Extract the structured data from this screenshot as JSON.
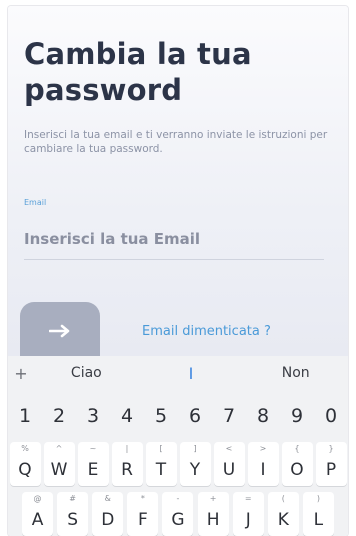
{
  "screen": {
    "title": "Cambia la tua password",
    "description": "Inserisci la tua email e ti verranno inviate le istruzioni per cambiare la tua password.",
    "email_label": "Email",
    "email_placeholder": "Inserisci la tua Email",
    "submit_icon": "arrow-right-icon",
    "forgot_link": "Email dimenticata ?",
    "colors": {
      "accent": "#4a9ad8",
      "title": "#2c3448",
      "button": "#a8aebf"
    }
  },
  "keyboard": {
    "suggestions": [
      "Ciao",
      "I",
      "Non"
    ],
    "plus": "+",
    "numbers": [
      "1",
      "2",
      "3",
      "4",
      "5",
      "6",
      "7",
      "8",
      "9",
      "0"
    ],
    "row_q": [
      {
        "key": "Q",
        "hint": "%"
      },
      {
        "key": "W",
        "hint": "^"
      },
      {
        "key": "E",
        "hint": "~"
      },
      {
        "key": "R",
        "hint": "|"
      },
      {
        "key": "T",
        "hint": "["
      },
      {
        "key": "Y",
        "hint": "]"
      },
      {
        "key": "U",
        "hint": "<"
      },
      {
        "key": "I",
        "hint": ">"
      },
      {
        "key": "O",
        "hint": "{"
      },
      {
        "key": "P",
        "hint": "}"
      }
    ],
    "row_a": [
      {
        "key": "A",
        "hint": "@"
      },
      {
        "key": "S",
        "hint": "#"
      },
      {
        "key": "D",
        "hint": "&"
      },
      {
        "key": "F",
        "hint": "*"
      },
      {
        "key": "G",
        "hint": "-"
      },
      {
        "key": "H",
        "hint": "+"
      },
      {
        "key": "J",
        "hint": "="
      },
      {
        "key": "K",
        "hint": "("
      },
      {
        "key": "L",
        "hint": ")"
      }
    ]
  }
}
